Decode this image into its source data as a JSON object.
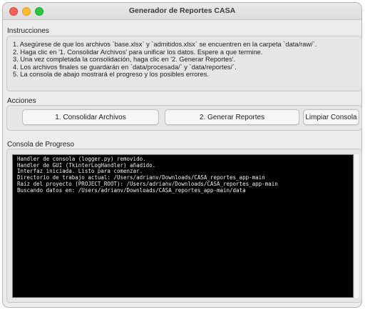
{
  "window": {
    "title": "Generador de Reportes CASA"
  },
  "instructions": {
    "label": "Instrucciones",
    "lines": [
      "1. Asegúrese de que los archivos `base.xlsx` y `admitidos.xlsx` se encuentren en la carpeta `data/raw/`.",
      "2. Haga clic en '1. Consolidar Archivos' para unificar los datos. Espere a que termine.",
      "3. Una vez completada la consolidación, haga clic en '2. Generar Reportes'.",
      "4. Los archivos finales se guardarán en `data/procesada/` y `data/reportes/`.",
      "5. La consola de abajo mostrará el progreso y los posibles errores."
    ]
  },
  "actions": {
    "label": "Acciones",
    "consolidate_label": "1. Consolidar Archivos",
    "generate_label": "2. Generar Reportes",
    "clear_label": "Limpiar Consola"
  },
  "console": {
    "label": "Consola de Progreso",
    "lines": [
      "Handler de consola (logger.py) removido.",
      "Handler de GUI (TkinterLogHandler) añadido.",
      "Interfaz iniciada. Listo para comenzar.",
      "Directorio de trabajo actual: /Users/adrianv/Downloads/CASA_reportes_app-main",
      "Raíz del proyecto (PROJECT_ROOT): /Users/adrianv/Downloads/CASA_reportes_app-main",
      "Buscando datos en: /Users/adrianv/Downloads/CASA_reportes_app-main/data"
    ]
  },
  "colors": {
    "close": "#fe5f57",
    "minimize": "#febc2e",
    "maximize": "#28c840",
    "console_bg": "#000000",
    "console_text": "#f2f2f2"
  }
}
